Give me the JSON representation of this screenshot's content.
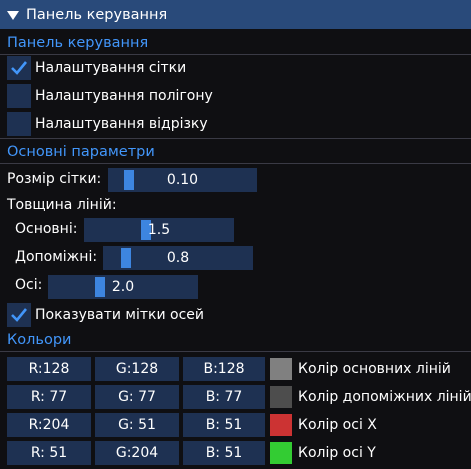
{
  "window": {
    "title": "Панель керування"
  },
  "panel": {
    "header": "Панель керування",
    "checkboxes": [
      {
        "label": "Налаштування сітки",
        "checked": true
      },
      {
        "label": "Налаштування полігону",
        "checked": false
      },
      {
        "label": "Налаштування відрізку",
        "checked": false
      }
    ]
  },
  "params": {
    "header": "Основні параметри",
    "grid_size_label": "Розмір сітки:",
    "grid_size_value": "0.10",
    "line_width_label": "Товщина ліній:",
    "main_label": "Основні:",
    "main_value": "1.5",
    "aux_label": "Допоміжні:",
    "aux_value": "0.8",
    "axes_label": "Осі:",
    "axes_value": "2.0",
    "show_axis_labels": {
      "label": "Показувати мітки осей",
      "checked": true
    }
  },
  "colors": {
    "header": "Кольори",
    "rows": [
      {
        "r": "R:128",
        "g": "G:128",
        "b": "B:128",
        "swatch": "#808080",
        "label": "Колір основних ліній"
      },
      {
        "r": "R: 77",
        "g": "G: 77",
        "b": "B: 77",
        "swatch": "#4d4d4d",
        "label": "Колір допоміжних ліній"
      },
      {
        "r": "R:204",
        "g": "G: 51",
        "b": "B: 51",
        "swatch": "#cc3333",
        "label": "Колір осі X"
      },
      {
        "r": "R: 51",
        "g": "G:204",
        "b": "B: 51",
        "swatch": "#33cc33",
        "label": "Колір осі Y"
      }
    ]
  },
  "theme": {
    "accent": "#4296fa",
    "title_bg": "#294a7a",
    "frame_bg": "#1e3152",
    "grab": "#3d85e0",
    "window_bg": "#0f0f12"
  }
}
